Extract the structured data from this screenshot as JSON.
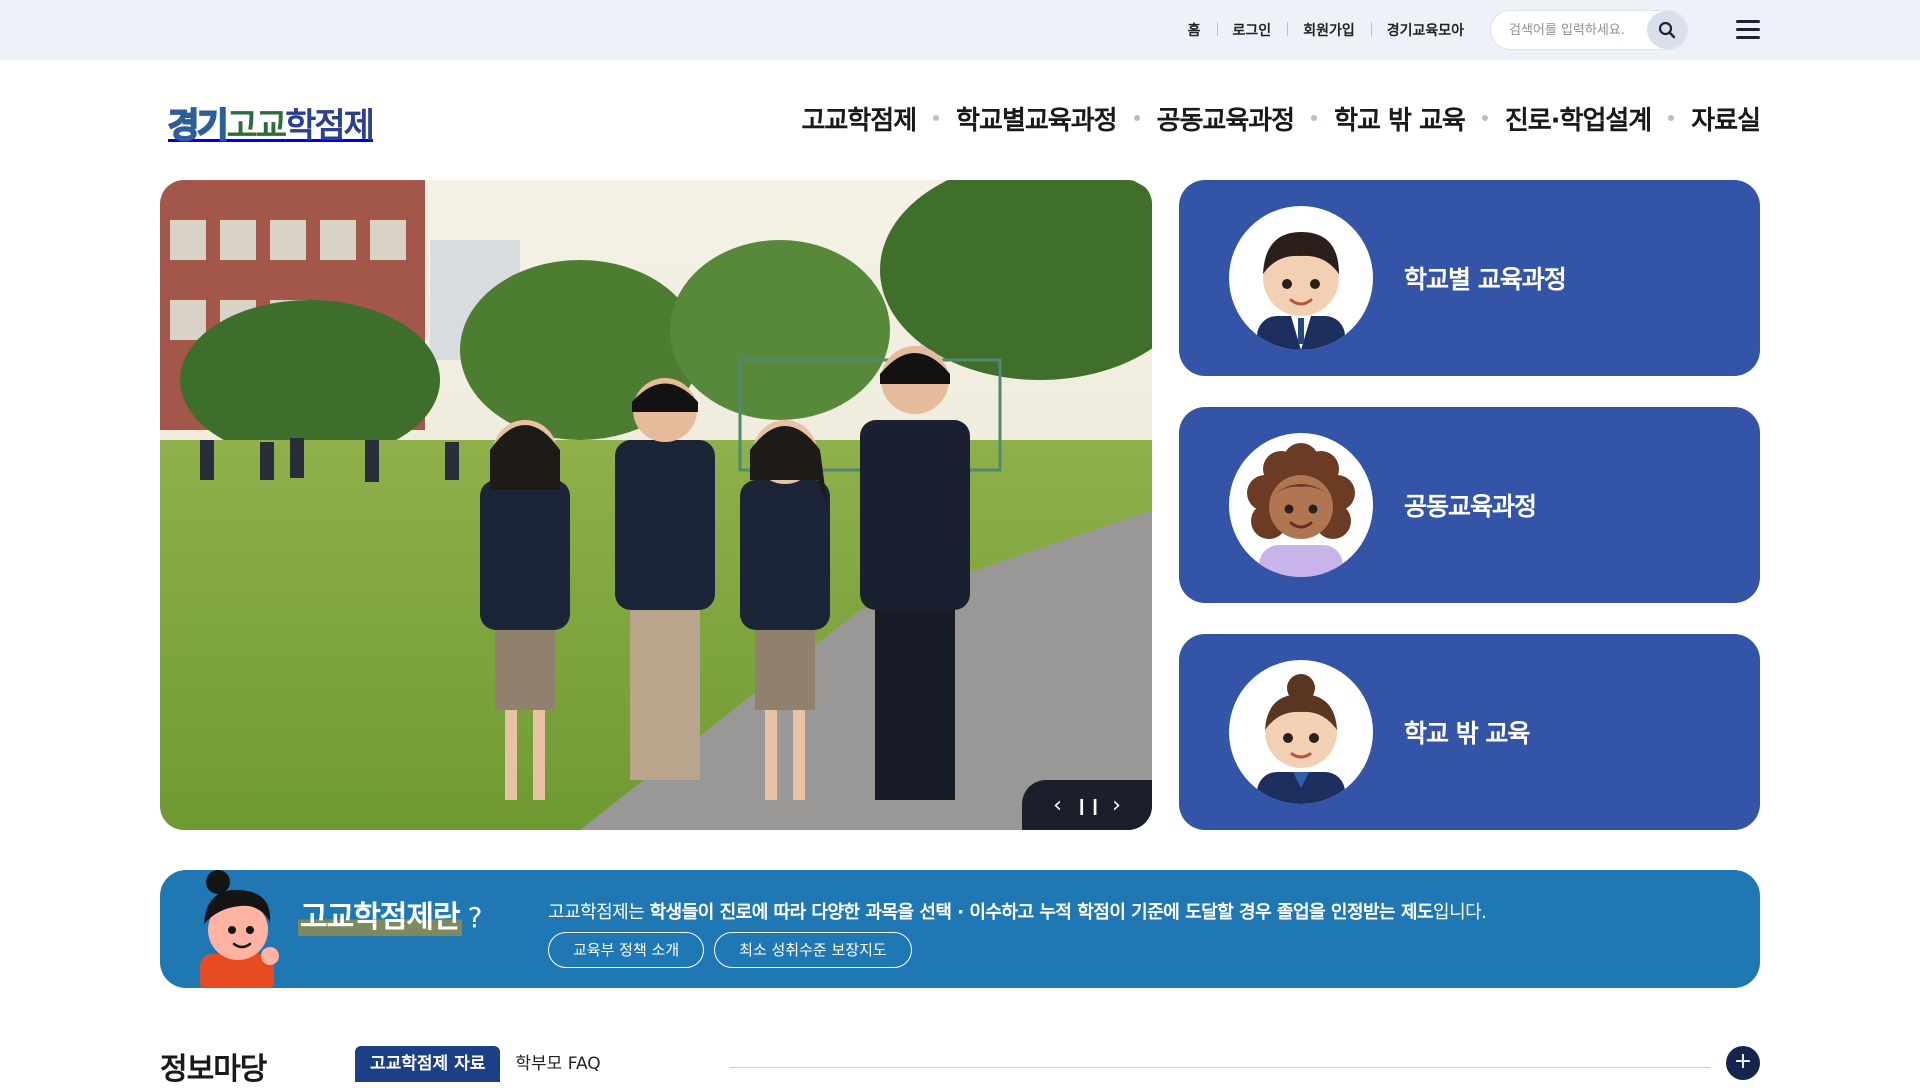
{
  "utility_nav": {
    "items": [
      "홈",
      "로그인",
      "회원가입",
      "경기교육모아"
    ]
  },
  "search": {
    "placeholder": "검색어를 입력하세요.",
    "icon": "search-icon"
  },
  "menu_icon": "hamburger-menu-icon",
  "logo": {
    "part1": "경기",
    "part2": "고교",
    "part3": "학점제"
  },
  "gnb": {
    "items": [
      "고교학점제",
      "학교별교육과정",
      "공동교육과정",
      "학교 밖 교육",
      "진로·학업설계",
      "자료실"
    ]
  },
  "hero": {
    "controls": {
      "prev_icon": "chevron-left-icon",
      "pause_icon": "pause-icon",
      "next_icon": "chevron-right-icon"
    }
  },
  "quick_cards": [
    {
      "label": "학교별 교육과정",
      "avatar": "boy-student-avatar"
    },
    {
      "label": "공동교육과정",
      "avatar": "curly-hair-girl-avatar"
    },
    {
      "label": "학교 밖 교육",
      "avatar": "girl-student-avatar"
    }
  ],
  "banner": {
    "title": "고교학점제란",
    "question_mark": "?",
    "desc_prefix": "고교학점제는 ",
    "desc_bold": "학생들이 진로에 따라 다양한 과목을 선택 · 이수하고 누적 학점이 기준에 도달할 경우 졸업을 인정받는 제도",
    "desc_suffix": "입니다.",
    "buttons": [
      "교육부 정책 소개",
      "최소 성취수준 보장지도"
    ]
  },
  "info": {
    "title": "정보마당",
    "tabs": [
      "고교학점제 자료",
      "학부모 FAQ"
    ],
    "active_tab": 0,
    "more_label": "+"
  },
  "colors": {
    "topbar_bg": "#eef1f8",
    "card_blue": "#3454a8",
    "banner_blue": "#1f78b3",
    "tab_active": "#1d3f86",
    "more_btn": "#16254f"
  }
}
